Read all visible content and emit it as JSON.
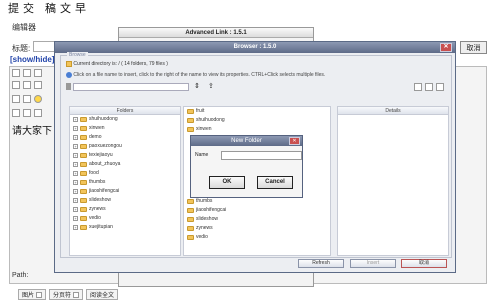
{
  "page": {
    "heading": "提交  稿文早",
    "subheading": "编辑器",
    "title_label": "标题:",
    "cancel": "取消"
  },
  "editor": {
    "toggle": "[show/hide]",
    "content": "请大家下",
    "path_label": "Path:"
  },
  "bottom_buttons": [
    "图片",
    "分页符",
    "阅读全文"
  ],
  "advanced_link": {
    "title": "Advanced Link : 1.5.1"
  },
  "browser": {
    "title": "Browser : 1.5.0",
    "legend": "Browse",
    "current_dir": "Current directory is: / ( 14 folders, 79 files )",
    "info": "Click on a file name to insert, click to the right of the name to view its properties. CTRL+Click selects multiple files.",
    "folders_header": "Folders",
    "details_header": "Details",
    "tree": [
      "shuihuodong",
      "xinwen",
      "demo",
      "paoxuezongou",
      "texiejiaoyu",
      "about_zhuoya",
      "food",
      "thumbs",
      "jiaoshifengcai",
      "slideshow",
      "zynews",
      "vedio",
      "xuejitupian"
    ],
    "files": [
      "fruit",
      "shuihuodong",
      "xinwen",
      "thumbs",
      "jiaoshifengcai",
      "slideshow",
      "zynews",
      "vedio"
    ],
    "buttons": {
      "refresh": "Refresh",
      "insert": "Insert",
      "cancel": "取消"
    }
  },
  "new_folder": {
    "title": "New Folder",
    "name_label": "Name",
    "name_value": "",
    "ok": "OK",
    "cancel": "Cancel"
  },
  "colors": {
    "titlebar": "#6a7692",
    "link": "#2244aa",
    "folder": "#f2c45a"
  }
}
